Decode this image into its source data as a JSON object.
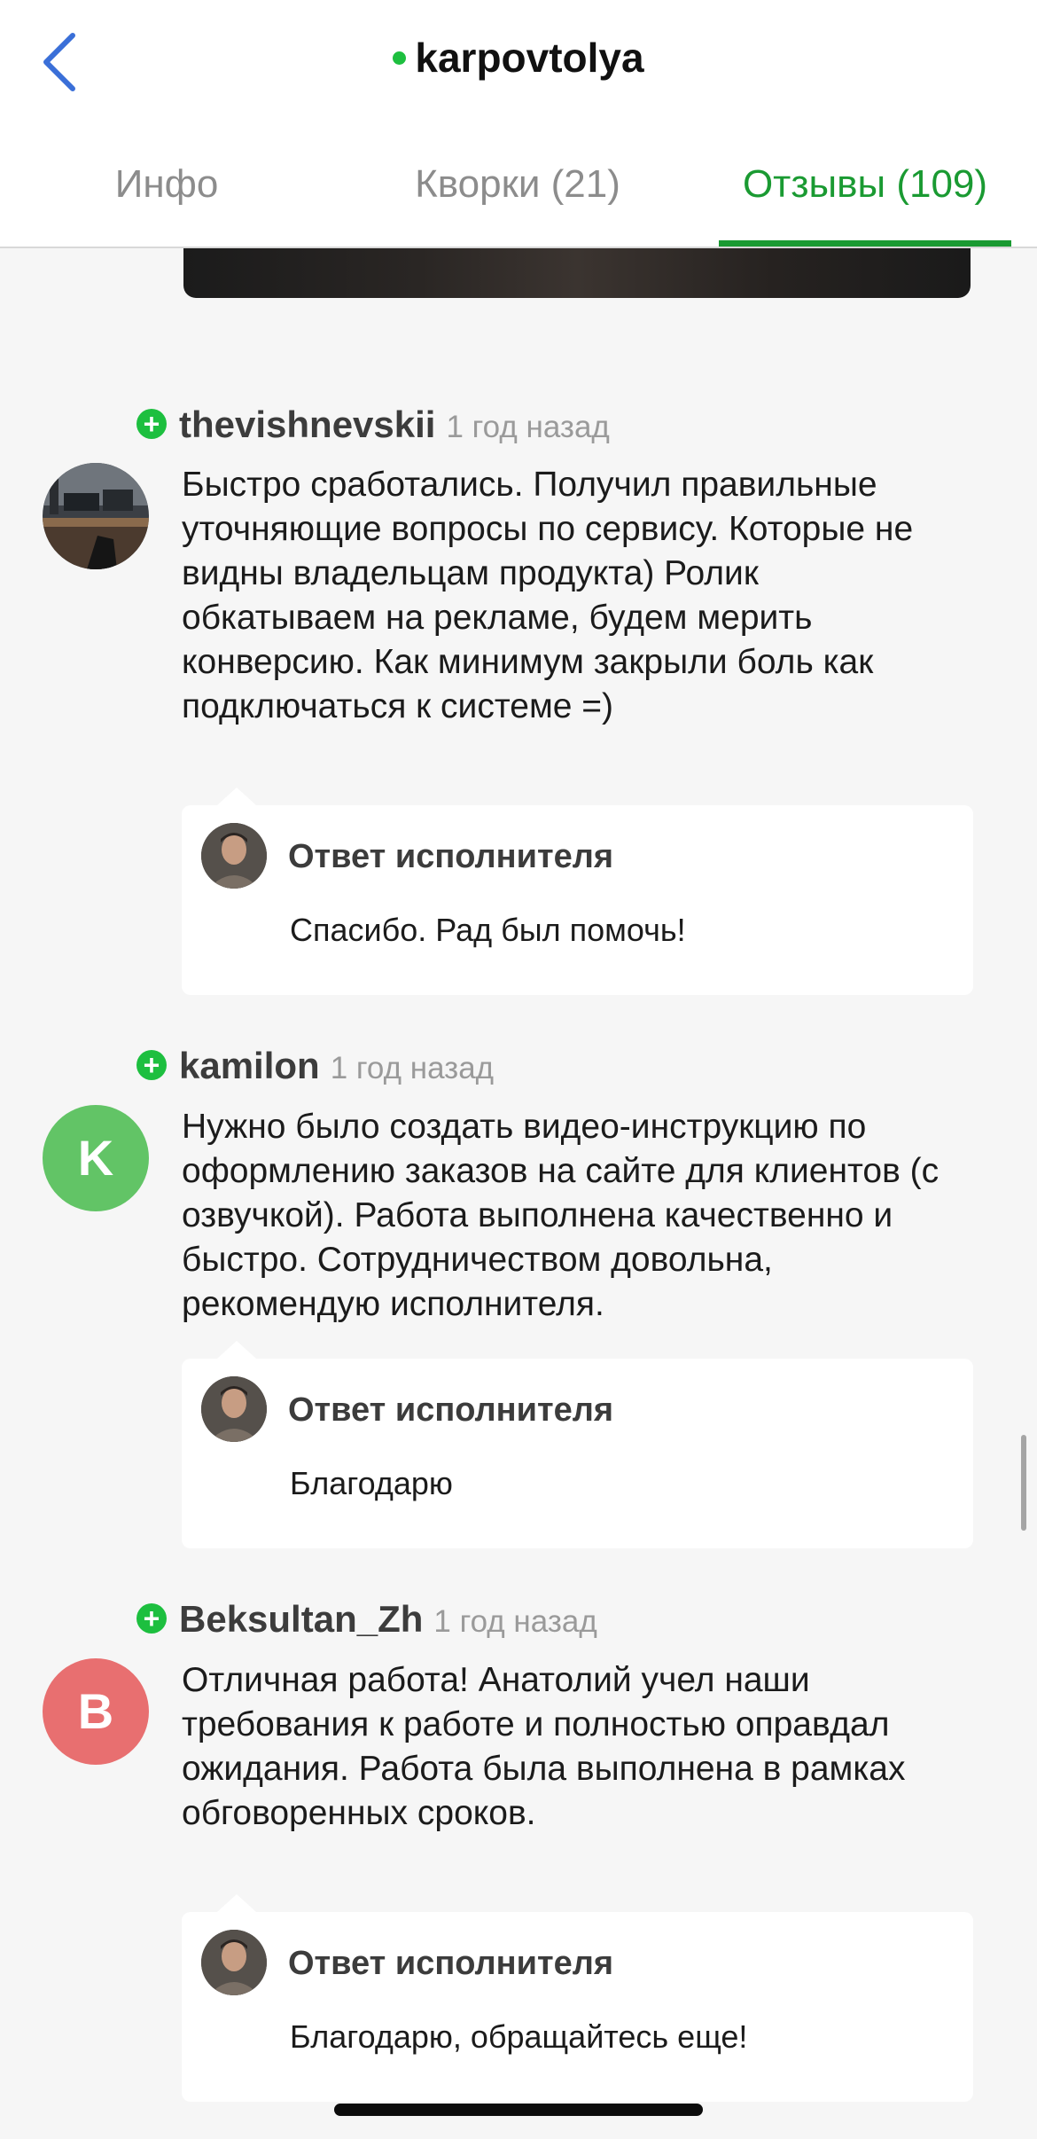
{
  "header": {
    "title": "karpovtolya",
    "tabs": [
      {
        "label": "Инфо",
        "active": false
      },
      {
        "label": "Кворки (21)",
        "active": false
      },
      {
        "label": "Отзывы (109)",
        "active": true
      }
    ]
  },
  "colors": {
    "accent": "#1a9a32",
    "online_dot": "#1dbf3f",
    "positive_badge": "#1dbf3f",
    "back_arrow": "#3a6fd8"
  },
  "icons": {
    "back": "chevron-left-icon",
    "positive": "plus-icon"
  },
  "reviews": [
    {
      "username": "thevishnevskii",
      "time": "1 год назад",
      "avatar_type": "photo",
      "text": "Быстро сработались. Получил правильные уточняющие вопросы по сервису. Которые не видны владельцам продукта) Ролик обкатываем на рекламе, будем мерить конверсию. Как минимум закрыли боль как подключаться к системе =)",
      "reply_title": "Ответ исполнителя",
      "reply_text": "Спасибо. Рад был помочь!"
    },
    {
      "username": "kamilon",
      "time": "1 год назад",
      "avatar_type": "letter",
      "avatar_letter": "K",
      "avatar_color": "#62c466",
      "text": "Нужно было создать видео-инструкцию по оформлению заказов на сайте для клиентов (с озвучкой). Работа выполнена качественно и быстро. Сотрудничеством довольна, рекомендую исполнителя.",
      "reply_title": "Ответ исполнителя",
      "reply_text": "Благодарю"
    },
    {
      "username": "Beksultan_Zh",
      "time": "1 год назад",
      "avatar_type": "letter",
      "avatar_letter": "B",
      "avatar_color": "#e86f70",
      "text": "Отличная работа! Анатолий учел наши требования к работе и полностью оправдал ожидания. Работа была выполнена в рамках обговоренных сроков.",
      "reply_title": "Ответ исполнителя",
      "reply_text": "Благодарю, обращайтесь еще!"
    }
  ]
}
